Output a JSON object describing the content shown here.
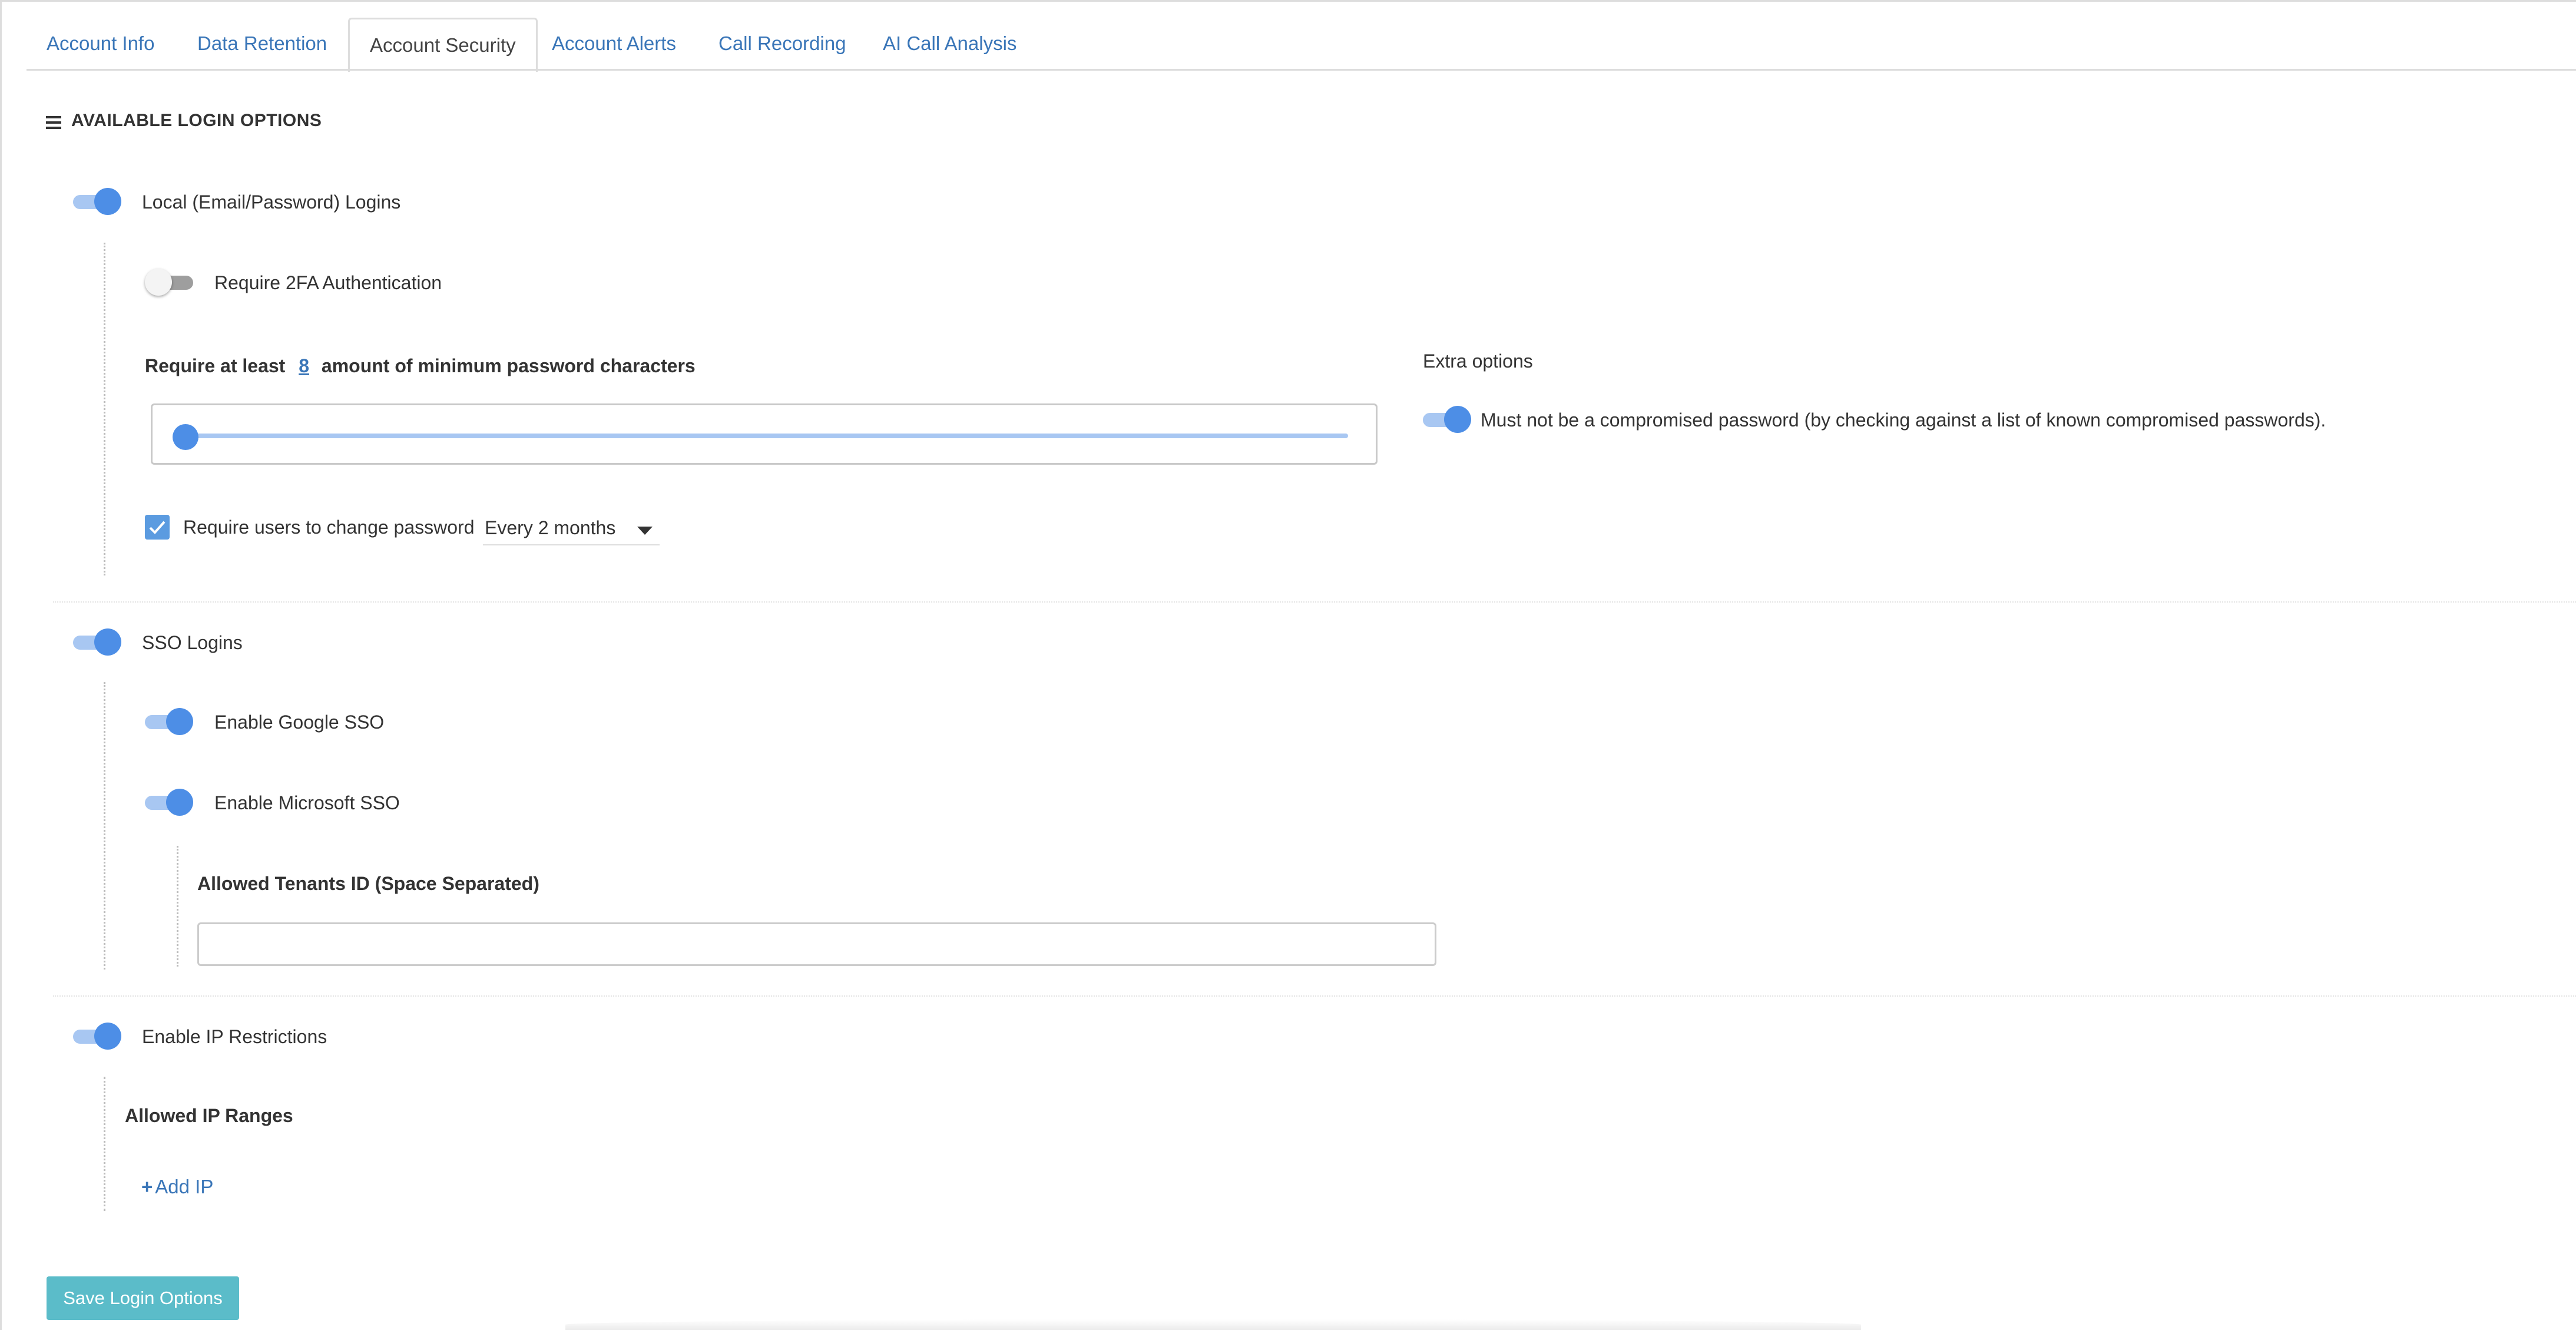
{
  "tabs": [
    {
      "label": "Account Info"
    },
    {
      "label": "Data Retention"
    },
    {
      "label": "Account Security"
    },
    {
      "label": "Account Alerts"
    },
    {
      "label": "Call Recording"
    },
    {
      "label": "AI Call Analysis"
    }
  ],
  "active_tab": "Account Security",
  "section": {
    "title": "AVAILABLE LOGIN OPTIONS",
    "icon": "menu-icon"
  },
  "local_login": {
    "label": "Local (Email/Password) Logins",
    "enabled": true,
    "require_2fa": {
      "label": "Require 2FA Authentication",
      "enabled": false
    },
    "min_chars": {
      "prefix": "Require at least",
      "value": "8",
      "suffix": "amount of minimum password characters"
    },
    "change_password": {
      "label": "Require users to change password",
      "checked": true,
      "interval": "Every 2 months"
    },
    "extra_options": {
      "title": "Extra options",
      "compromised": {
        "label": "Must not be a compromised password (by checking against a list of known compromised passwords).",
        "enabled": true
      }
    }
  },
  "sso": {
    "label": "SSO Logins",
    "enabled": true,
    "google": {
      "label": "Enable Google SSO",
      "enabled": true
    },
    "microsoft": {
      "label": "Enable Microsoft SSO",
      "enabled": true
    },
    "tenants": {
      "label": "Allowed Tenants ID (Space Separated)",
      "value": ""
    }
  },
  "ip": {
    "label": "Enable IP Restrictions",
    "enabled": true,
    "ranges_label": "Allowed IP Ranges",
    "add_label": "Add IP"
  },
  "save_label": "Save Login Options",
  "colors": {
    "link": "#3a76b8",
    "toggle_on": "#4d8ee6",
    "toggle_track": "#a8c7f2",
    "save_button": "#5bbcc9"
  }
}
